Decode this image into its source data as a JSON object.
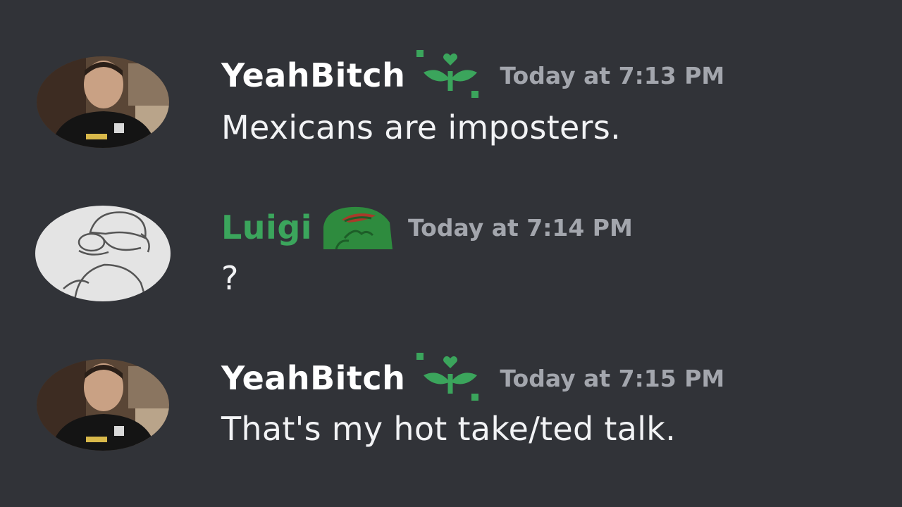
{
  "theme": {
    "background": "#313338",
    "text": "#f2f3f5",
    "timestamp": "#a3a6ad"
  },
  "messages": [
    {
      "username": "YeahBitch",
      "username_color": "#ffffff",
      "badge_icon": "sprout-icon",
      "timestamp": "Today at 7:13 PM",
      "content": "Mexicans are imposters."
    },
    {
      "username": "Luigi",
      "username_color": "#3ba55c",
      "badge_icon": "pepe-frog-icon",
      "timestamp": "Today at 7:14 PM",
      "content": "?"
    },
    {
      "username": "YeahBitch",
      "username_color": "#ffffff",
      "badge_icon": "sprout-icon",
      "timestamp": "Today at 7:15 PM",
      "content": "That's my hot take/ted talk."
    }
  ]
}
